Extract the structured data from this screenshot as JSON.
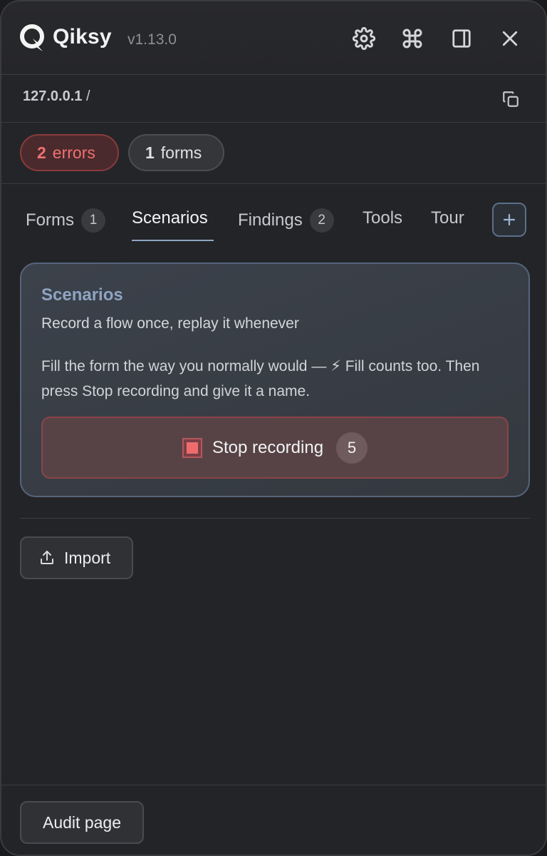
{
  "header": {
    "brand": "Qiksy",
    "version": "v1.13.0",
    "icons": [
      "gear-icon",
      "command-icon",
      "sidebar-icon",
      "close-icon"
    ]
  },
  "url_bar": {
    "host": "127.0.0.1",
    "path": " /",
    "copy_icon": "copy-icon"
  },
  "badges": {
    "errors": {
      "count": "2",
      "label": "errors",
      "color": "#f07173"
    },
    "forms": {
      "count": "1",
      "label": "forms"
    }
  },
  "tabs": [
    {
      "label": "Forms",
      "count": "1"
    },
    {
      "label": "Scenarios",
      "active": true
    },
    {
      "label": "Findings",
      "count": "2"
    },
    {
      "label": "Tools"
    },
    {
      "label": "Tour"
    }
  ],
  "card": {
    "title": "Scenarios",
    "subtitle": "Record a flow once, replay it whenever",
    "description": "Fill the form the way you normally would — ⚡ Fill counts too. Then press Stop recording and give it a name.",
    "stop_label": "Stop recording",
    "stop_count": "5"
  },
  "actions": {
    "import_label": "Import",
    "audit_label": "Audit page"
  },
  "colors": {
    "accent": "#8fa4c2",
    "error": "#f07173",
    "background": "#232427"
  }
}
